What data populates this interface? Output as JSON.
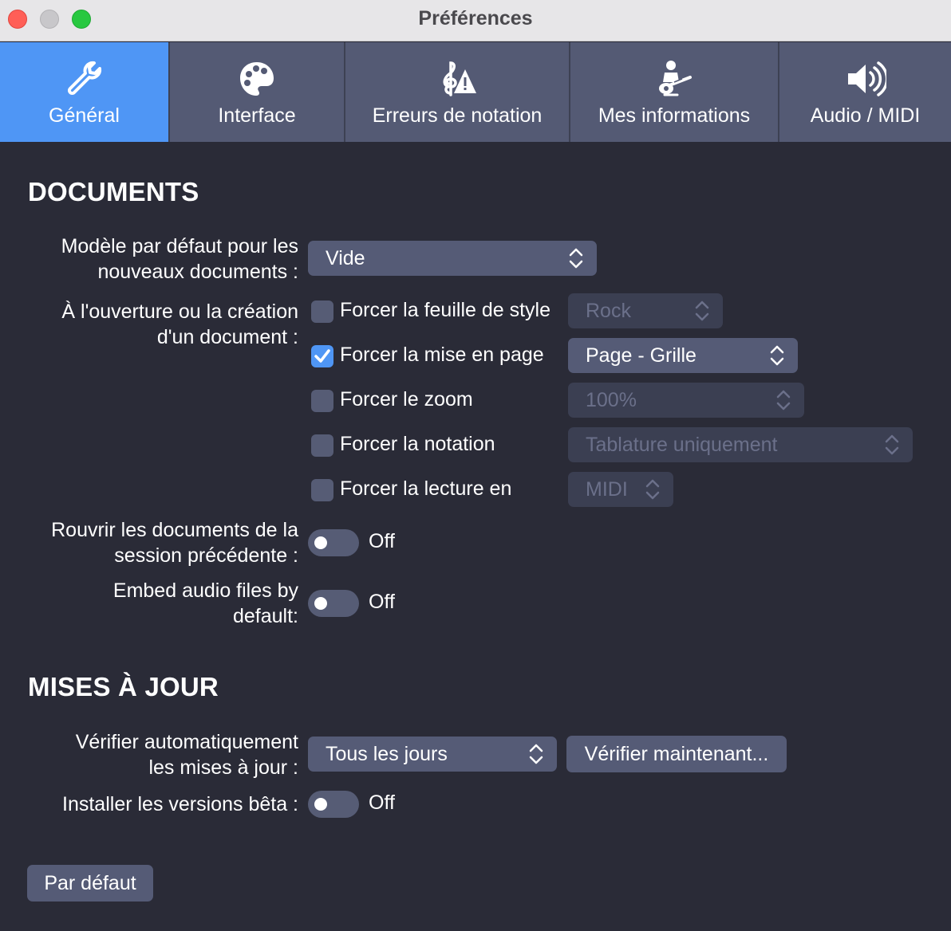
{
  "window": {
    "title": "Préférences"
  },
  "tabs": [
    {
      "label": "Général",
      "icon": "wrench-icon",
      "active": true
    },
    {
      "label": "Interface",
      "icon": "palette-icon",
      "active": false
    },
    {
      "label": "Erreurs de notation",
      "icon": "clef-warning-icon",
      "active": false
    },
    {
      "label": "Mes informations",
      "icon": "guitarist-icon",
      "active": false
    },
    {
      "label": "Audio / MIDI",
      "icon": "speaker-icon",
      "active": false
    }
  ],
  "documents": {
    "title": "DOCUMENTS",
    "template_label_line1": "Modèle par défaut pour les",
    "template_label_line2": "nouveaux documents :",
    "template_value": "Vide",
    "open_label_line1": "À l'ouverture ou la création",
    "open_label_line2": "d'un document :",
    "options": [
      {
        "label": "Forcer la feuille de style",
        "checked": false,
        "value": "Rock"
      },
      {
        "label": "Forcer la mise en page",
        "checked": true,
        "value": "Page - Grille"
      },
      {
        "label": "Forcer le zoom",
        "checked": false,
        "value": "100%"
      },
      {
        "label": "Forcer la notation",
        "checked": false,
        "value": "Tablature uniquement"
      },
      {
        "label": "Forcer la lecture en",
        "checked": false,
        "value": "MIDI"
      }
    ],
    "reopen_label_line1": "Rouvrir les documents de la",
    "reopen_label_line2": "session précédente :",
    "reopen_state": "Off",
    "embed_label_line1": "Embed audio files by",
    "embed_label_line2": "default:",
    "embed_state": "Off"
  },
  "updates": {
    "title": "MISES À JOUR",
    "check_label_line1": "Vérifier automatiquement",
    "check_label_line2": "les mises à jour :",
    "check_value": "Tous les jours",
    "check_now_button": "Vérifier maintenant...",
    "beta_label": "Installer les versions bêta :",
    "beta_state": "Off"
  },
  "footer": {
    "defaults_button": "Par défaut"
  },
  "colors": {
    "accent": "#4f96f5",
    "background": "#2a2b37",
    "control": "#555b76",
    "tab": "#545a74"
  }
}
